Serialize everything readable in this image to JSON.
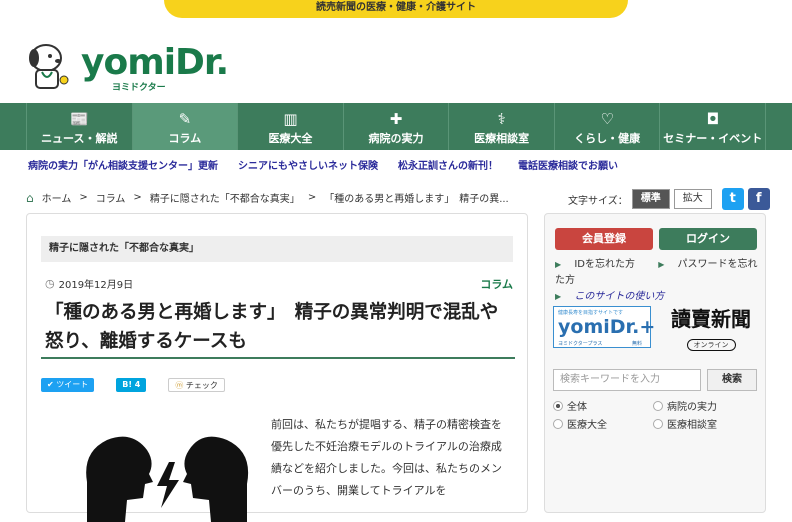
{
  "topbar": {
    "text": "読売新聞の医療・健康・介護サイト"
  },
  "logo": {
    "word": "yomiDr.",
    "sub": "ヨミドクター"
  },
  "nav": {
    "items": [
      {
        "label": "ニュース・解説",
        "icon": "newspaper-icon",
        "glyph": "📰"
      },
      {
        "label": "コラム",
        "icon": "pen-icon",
        "glyph": "✎"
      },
      {
        "label": "医療大全",
        "icon": "books-icon",
        "glyph": "▥"
      },
      {
        "label": "病院の実力",
        "icon": "hospital-icon",
        "glyph": "✚"
      },
      {
        "label": "医療相談室",
        "icon": "stethoscope-icon",
        "glyph": "⚕"
      },
      {
        "label": "くらし・健康",
        "icon": "heart-icon",
        "glyph": "♡"
      },
      {
        "label": "セミナー・イベント",
        "icon": "podium-icon",
        "glyph": "◘"
      }
    ],
    "active": 1
  },
  "news": [
    "病院の実力「がん相談支援センター」更新",
    "シニアにもやさしいネット保険",
    "松永正訓さんの新刊！",
    "電話医療相談でお願い"
  ],
  "breadcrumb": {
    "home": "ホーム",
    "sep": ">",
    "items": [
      "コラム",
      "精子に隠された「不都合な真実」",
      "「種のある男と再婚します」　精子の異..."
    ]
  },
  "fontsize": {
    "label": "文字サイズ：",
    "standard": "標準",
    "large": "拡大"
  },
  "sns": {
    "twitter": "t",
    "facebook": "f"
  },
  "article": {
    "category": "精子に隠された「不都合な真実」",
    "date": "2019年12月9日",
    "column": "コラム",
    "title": "「種のある男と再婚します」　精子の異常判明で混乱や怒り、離婚するケースも",
    "share": {
      "tweet": "ツイート",
      "hatena": "B!",
      "hatena_count": "4",
      "check": "チェック"
    },
    "body": "前回は、私たちが提唱する、精子の精密検査を優先した不妊治療モデルのトライアルの治療成績などを紹介しました。今回は、私たちのメンバーのうち、開業してトライアルを"
  },
  "sidebar": {
    "register": "会員登録",
    "login": "ログイン",
    "links": [
      "IDを忘れた方",
      "パスワードを忘れた方",
      "このサイトの使い方"
    ],
    "banner": {
      "small": "健康長寿を目指すサイトです",
      "word": "yomiDr.+",
      "sub": "ヨミドクタープラス",
      "free": "無料"
    },
    "yomiuri": {
      "title": "讀賣新聞",
      "online": "オンライン"
    },
    "search": {
      "placeholder": "検索キーワードを入力",
      "button": "検索"
    },
    "radios": [
      "全体",
      "病院の実力",
      "医療大全",
      "医療相談室"
    ],
    "selected": 0
  },
  "colors": {
    "green": "#3d7c5c",
    "yellow": "#f7d21c",
    "red": "#c9453f",
    "link": "#2a2a9a",
    "twitter": "#1da1f2",
    "facebook": "#3b5998"
  }
}
